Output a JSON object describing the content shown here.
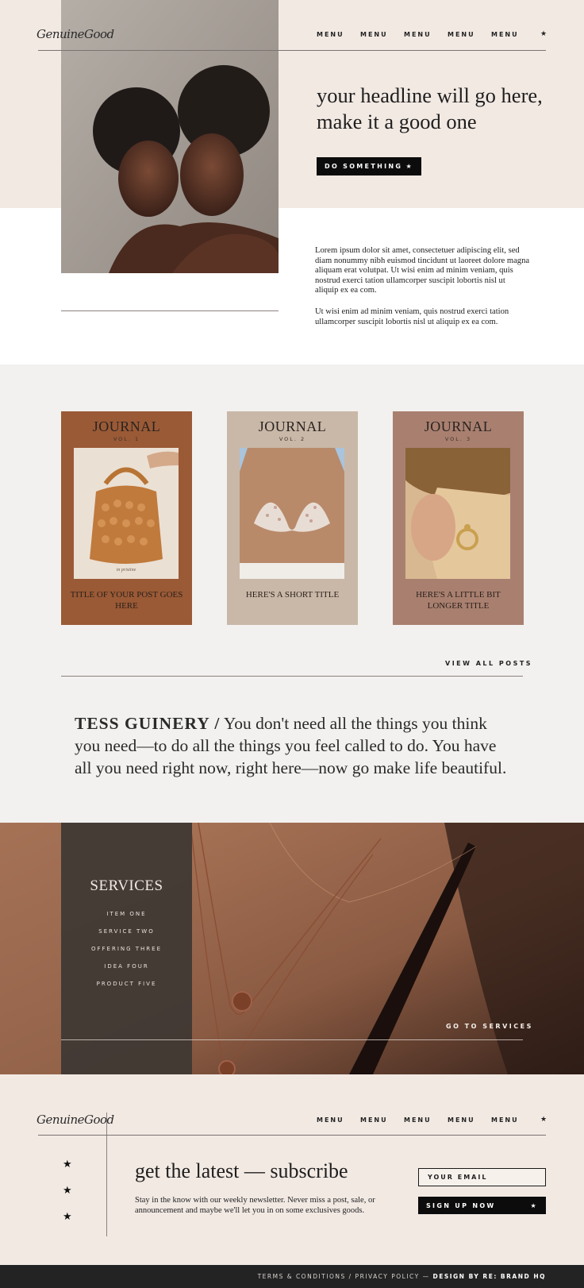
{
  "header": {
    "logo": "GenuineGood",
    "nav": [
      "MENU",
      "MENU",
      "MENU",
      "MENU",
      "MENU"
    ],
    "star": "★"
  },
  "hero": {
    "headline_line1": "your headline will go here,",
    "headline_line2": "make it a good one",
    "button_label": "DO SOMETHING",
    "button_star": "★"
  },
  "intro": {
    "paragraph1": "Lorem ipsum dolor sit amet, consectetuer adipiscing elit, sed diam nonummy nibh euismod tincidunt ut laoreet dolore magna aliquam erat volutpat. Ut wisi enim ad minim veniam, quis nostrud exerci tation ullamcorper suscipit lobortis nisl ut aliquip ex ea com.",
    "paragraph2": "Ut wisi enim ad minim veniam, quis nostrud exerci tation ullamcorper suscipit lobortis nisl ut aliquip ex ea com."
  },
  "journal": {
    "cards": [
      {
        "title": "JOURNAL",
        "vol": "VOL. 1",
        "caption": "TITLE OF YOUR POST GOES HERE",
        "color": "#9a5a36",
        "img_note": "in pristine"
      },
      {
        "title": "JOURNAL",
        "vol": "VOL. 2",
        "caption": "HERE'S A SHORT TITLE",
        "color": "#c9b8a8"
      },
      {
        "title": "JOURNAL",
        "vol": "VOL. 3",
        "caption": "HERE'S A LITTLE BIT LONGER TITLE",
        "color": "#a98070"
      }
    ],
    "view_all": "VIEW ALL POSTS"
  },
  "quote": {
    "author": "TESS GUINERY /",
    "text": "You don't need all the things you think you need—to do all the things you feel called to do. You have all you need right now, right here—now go make life beautiful."
  },
  "services": {
    "title": "SERVICES",
    "items": [
      "ITEM ONE",
      "SERVICE TWO",
      "OFFERING THREE",
      "IDEA FOUR",
      "PRODUCT FIVE"
    ],
    "link": "GO TO SERVICES"
  },
  "footer": {
    "logo": "GenuineGood",
    "nav": [
      "MENU",
      "MENU",
      "MENU",
      "MENU",
      "MENU"
    ],
    "star": "★",
    "stars": [
      "★",
      "★",
      "★"
    ],
    "subscribe_title": "get the latest — subscribe",
    "subscribe_text": "Stay in the know with our weekly newsletter. Never miss a post, sale, or announcement and maybe we'll let you in on some exclusives goods.",
    "email_placeholder": "YOUR EMAIL",
    "signup_label": "SIGN UP NOW",
    "signup_star": "★",
    "legal": "TERMS & CONDITIONS / PRIVACY POLICY — ",
    "credit": "DESIGN BY RE: BRAND HQ"
  }
}
